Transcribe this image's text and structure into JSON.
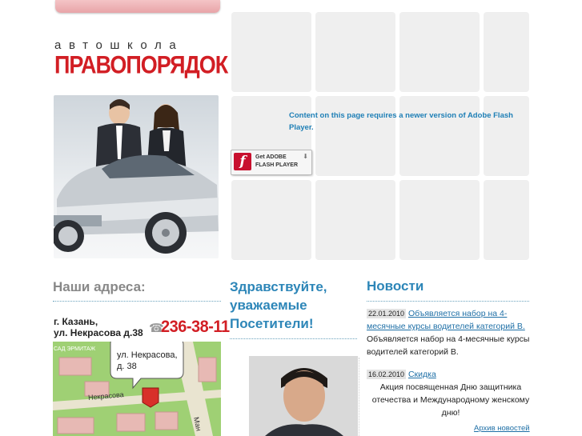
{
  "brand": {
    "subtitle": "автошкола",
    "name": "ПРАВОПОРЯДОК"
  },
  "flash": {
    "message": "Content on this page requires a newer version of Adobe Flash Player.",
    "badge_line1": "Get ADOBE",
    "badge_line2": "FLASH PLAYER",
    "icon": "flash-icon"
  },
  "addresses": {
    "heading": "Наши адреса:",
    "city": "г. Казань,",
    "street": "ул. Некрасова д.38",
    "phone": "236-38-11",
    "phone_icon": "phone-icon",
    "map": {
      "bubble_line1": "ул. Некрасова,",
      "bubble_line2": "д. 38",
      "label_park": "САД ЭРМИТАЖ",
      "label_street": "Некрасова",
      "label_side": "Ман"
    }
  },
  "welcome": {
    "line1": "Здравствуйте,",
    "line2": "уважаемые",
    "line3": "Посетители!"
  },
  "news": {
    "heading": "Новости",
    "items": [
      {
        "date": "22.01.2010",
        "title": "Объявляется набор на 4-месячные курсы водителей категорий В.",
        "text": "Объявляется набор на 4-месячные курсы водителей категорий В."
      },
      {
        "date": "16.02.2010",
        "title": "Скидка",
        "text": "Акция посвященная Дню защитника отечества и Международному женскому дню!"
      }
    ],
    "archive": "Архив новостей"
  },
  "colors": {
    "brand_red": "#d21e24",
    "accent_blue": "#2d86b8",
    "link_blue": "#1e6fa6"
  }
}
